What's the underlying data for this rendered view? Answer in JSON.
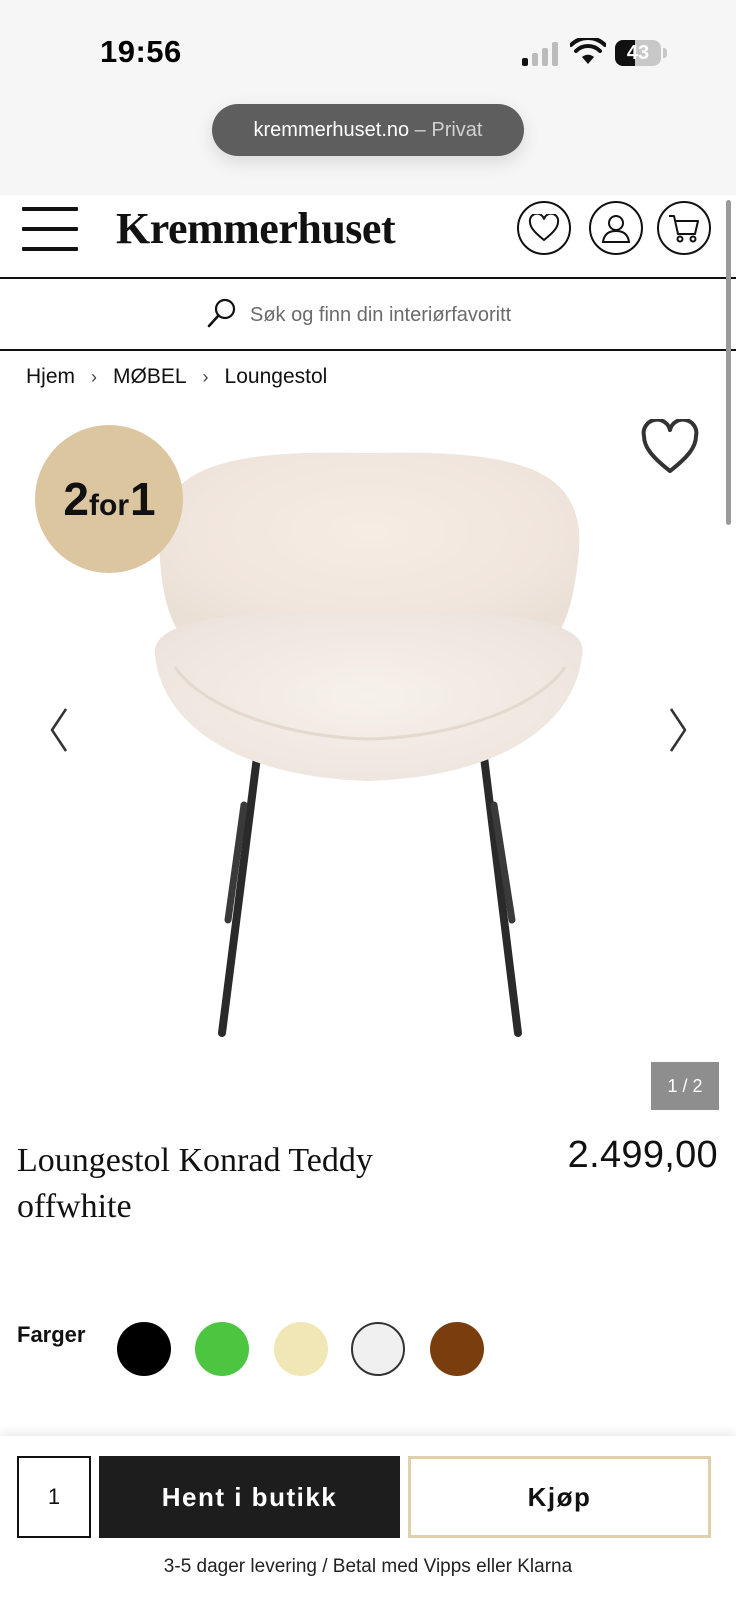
{
  "status_bar": {
    "time": "19:56",
    "battery_level": "43",
    "battery_fraction": 0.43,
    "signal_bars_active": 1,
    "signal_bars_total": 4
  },
  "browser": {
    "domain": "kremmerhuset.no",
    "mode": " – Privat"
  },
  "header": {
    "logo": "Kremmerhuset",
    "icons": [
      "menu-icon",
      "heart-icon",
      "user-icon",
      "cart-icon"
    ]
  },
  "search": {
    "placeholder": "Søk og finn din interiørfavoritt",
    "value": ""
  },
  "breadcrumb": {
    "items": [
      "Hjem",
      "MØBEL",
      "Loungestol"
    ],
    "separator": "›"
  },
  "gallery": {
    "badge_big_1": "2",
    "badge_small": "for",
    "badge_big_2": "1",
    "counter": "1 / 2",
    "badge_color": "#dcc6a0"
  },
  "product": {
    "title": "Loungestol Konrad Teddy offwhite",
    "price": "2.499,00"
  },
  "colors": {
    "label": "Farger",
    "swatches": [
      {
        "name": "black",
        "hex": "#000000"
      },
      {
        "name": "green",
        "hex": "#4cc641"
      },
      {
        "name": "cream",
        "hex": "#f1e7b6"
      },
      {
        "name": "offwhite",
        "hex": "#f0f0f0"
      },
      {
        "name": "brown",
        "hex": "#7a3e0e"
      }
    ]
  },
  "purchase": {
    "quantity": "1",
    "pickup_label": "Hent i butikk",
    "buy_label": "Kjøp",
    "delivery_note": "3-5 dager levering / Betal med Vipps eller Klarna"
  }
}
